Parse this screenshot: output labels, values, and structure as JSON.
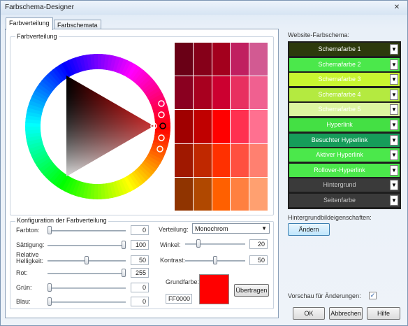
{
  "window": {
    "title": "Farbschema-Designer",
    "close_glyph": "✕"
  },
  "tabs": [
    {
      "label": "Farbverteilung",
      "active": true
    },
    {
      "label": "Farbschemata",
      "active": false
    }
  ],
  "wheel_group": {
    "label": "Farbverteilung"
  },
  "swatches": [
    [
      "#6a0016",
      "#860019",
      "#a3001d",
      "#c02060",
      "#d25a92"
    ],
    [
      "#8a0020",
      "#a8001f",
      "#cc0030",
      "#e83060",
      "#f06090"
    ],
    [
      "#a00000",
      "#c00000",
      "#ff0000",
      "#ff3050",
      "#ff7090"
    ],
    [
      "#a01800",
      "#c02800",
      "#ff3000",
      "#ff5040",
      "#ff8070"
    ],
    [
      "#903400",
      "#b04800",
      "#ff6000",
      "#ff8040",
      "#ffa070"
    ]
  ],
  "config": {
    "group_label": "Konfiguration der Farbverteilung",
    "sliders": [
      {
        "label": "Farbton:",
        "value": "0",
        "level": 0.0
      },
      {
        "label": "Sättigung:",
        "value": "100",
        "level": 1.0
      },
      {
        "label": "Relative Helligkeit:",
        "value": "50",
        "level": 0.5
      },
      {
        "label": "Rot:",
        "value": "255",
        "level": 1.0
      },
      {
        "label": "Grün:",
        "value": "0",
        "level": 0.0
      },
      {
        "label": "Blau:",
        "value": "0",
        "level": 0.0
      }
    ],
    "verteilung_label": "Verteilung:",
    "verteilung_value": "Monochrom",
    "winkel_label": "Winkel:",
    "winkel_value": "20",
    "winkel_level": 0.2,
    "kontrast_label": "Kontrast:",
    "kontrast_value": "50",
    "kontrast_level": 0.5,
    "grundfarbe_label": "Grundfarbe:",
    "grundfarbe_hex": "FF0000",
    "grundfarbe_color": "#ff0000",
    "uebertragen_label": "Übertragen"
  },
  "scheme": {
    "label": "Website-Farbschema:",
    "rows": [
      {
        "label": "Schemafarbe 1",
        "bg": "#2d3a0c",
        "fg": "#ffffff"
      },
      {
        "label": "Schemafarbe 2",
        "bg": "#4be84b",
        "fg": "#ffffff"
      },
      {
        "label": "Schemafarbe 3",
        "bg": "#c8f530",
        "fg": "#ffffff"
      },
      {
        "label": "Schemafarbe 4",
        "bg": "#b4ea40",
        "fg": "#ffffff"
      },
      {
        "label": "Schemafarbe 5",
        "bg": "#dcf5a0",
        "fg": "#ffffff"
      },
      {
        "label": "Hyperlink",
        "bg": "#44e044",
        "fg": "#ffffff"
      },
      {
        "label": "Besuchter Hyperlink",
        "bg": "#169c5a",
        "fg": "#ffffff"
      },
      {
        "label": "Aktiver Hyperlink",
        "bg": "#4be84b",
        "fg": "#ffffff"
      },
      {
        "label": "Rollover-Hyperlink",
        "bg": "#4be84b",
        "fg": "#ffffff"
      },
      {
        "label": "Hintergrund",
        "bg": "#3a3a3a",
        "fg": "#c8c8c8"
      },
      {
        "label": "Seitenfarbe",
        "bg": "#3a3a3a",
        "fg": "#c8c8c8"
      }
    ],
    "dd_glyph": "▼"
  },
  "background": {
    "label": "Hintergrundbildeigenschaften:",
    "button": "Ändern"
  },
  "preview": {
    "label": "Vorschau für Änderungen:",
    "checked_glyph": "✓"
  },
  "footer": {
    "ok": "OK",
    "cancel": "Abbrechen",
    "help": "Hilfe"
  }
}
